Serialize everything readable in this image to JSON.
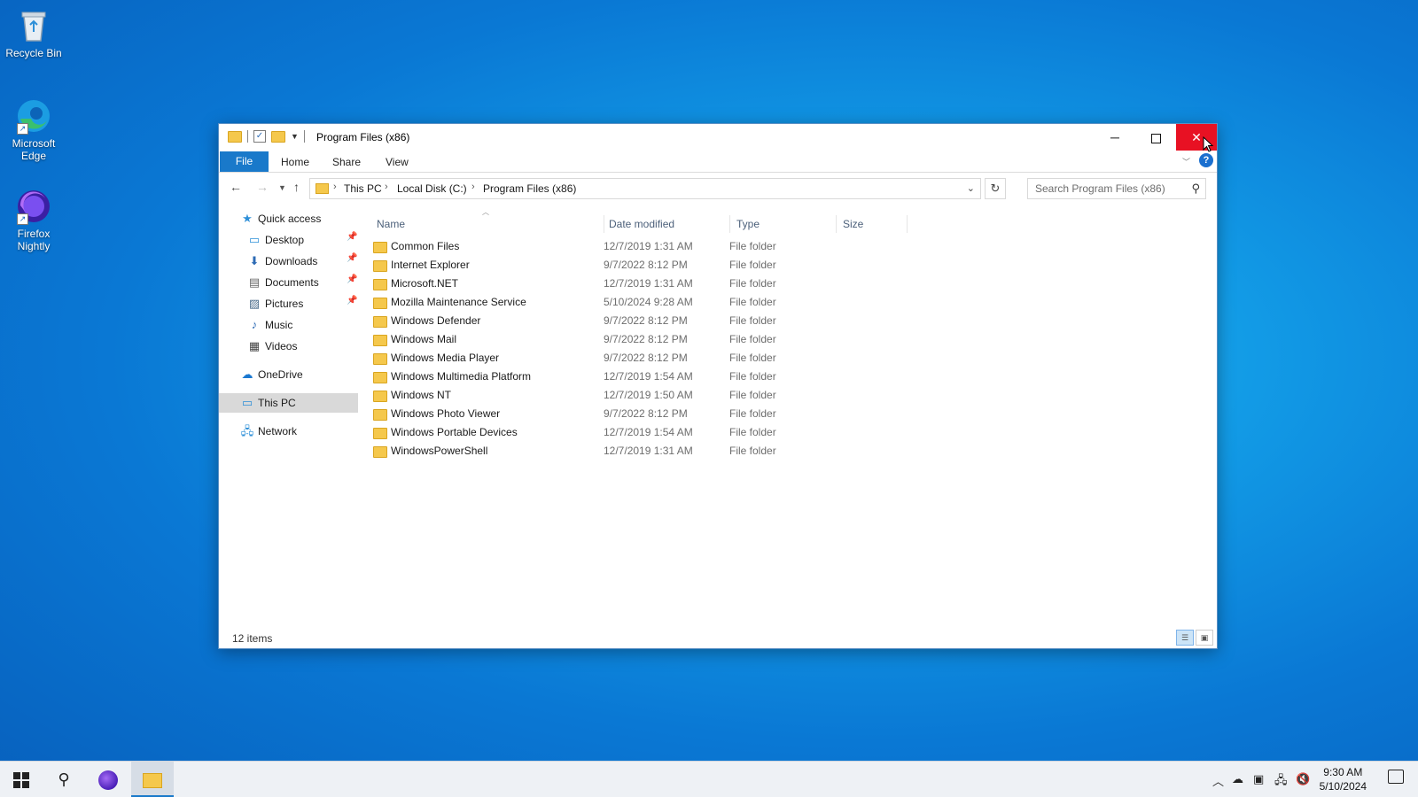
{
  "desktop": {
    "icons": [
      {
        "label": "Recycle Bin"
      },
      {
        "label": "Microsoft Edge"
      },
      {
        "label": "Firefox Nightly"
      }
    ]
  },
  "window": {
    "title": "Program Files (x86)",
    "ribbon_tabs": [
      "File",
      "Home",
      "Share",
      "View"
    ],
    "address": {
      "crumbs": [
        "This PC",
        "Local Disk (C:)",
        "Program Files (x86)"
      ]
    },
    "search": {
      "placeholder": "Search Program Files (x86)"
    },
    "nav_pane": {
      "quick_access": "Quick access",
      "items": [
        {
          "label": "Desktop",
          "icon": "desktop-icon",
          "pinned": true
        },
        {
          "label": "Downloads",
          "icon": "downloads-icon",
          "pinned": true
        },
        {
          "label": "Documents",
          "icon": "documents-icon",
          "pinned": true
        },
        {
          "label": "Pictures",
          "icon": "pictures-icon",
          "pinned": true
        },
        {
          "label": "Music",
          "icon": "music-icon",
          "pinned": false
        },
        {
          "label": "Videos",
          "icon": "videos-icon",
          "pinned": false
        }
      ],
      "onedrive": "OneDrive",
      "this_pc": "This PC",
      "network": "Network",
      "selected": "This PC"
    },
    "columns": {
      "name": "Name",
      "date": "Date modified",
      "type": "Type",
      "size": "Size"
    },
    "files": [
      {
        "name": "Common Files",
        "date": "12/7/2019 1:31 AM",
        "type": "File folder"
      },
      {
        "name": "Internet Explorer",
        "date": "9/7/2022 8:12 PM",
        "type": "File folder"
      },
      {
        "name": "Microsoft.NET",
        "date": "12/7/2019 1:31 AM",
        "type": "File folder"
      },
      {
        "name": "Mozilla Maintenance Service",
        "date": "5/10/2024 9:28 AM",
        "type": "File folder"
      },
      {
        "name": "Windows Defender",
        "date": "9/7/2022 8:12 PM",
        "type": "File folder"
      },
      {
        "name": "Windows Mail",
        "date": "9/7/2022 8:12 PM",
        "type": "File folder"
      },
      {
        "name": "Windows Media Player",
        "date": "9/7/2022 8:12 PM",
        "type": "File folder"
      },
      {
        "name": "Windows Multimedia Platform",
        "date": "12/7/2019 1:54 AM",
        "type": "File folder"
      },
      {
        "name": "Windows NT",
        "date": "12/7/2019 1:50 AM",
        "type": "File folder"
      },
      {
        "name": "Windows Photo Viewer",
        "date": "9/7/2022 8:12 PM",
        "type": "File folder"
      },
      {
        "name": "Windows Portable Devices",
        "date": "12/7/2019 1:54 AM",
        "type": "File folder"
      },
      {
        "name": "WindowsPowerShell",
        "date": "12/7/2019 1:31 AM",
        "type": "File folder"
      }
    ],
    "status": "12 items"
  },
  "taskbar": {
    "clock_time": "9:30 AM",
    "clock_date": "5/10/2024"
  },
  "colors": {
    "accent": "#1979ca",
    "close_hover": "#e81123",
    "folder": "#f5c84c"
  }
}
